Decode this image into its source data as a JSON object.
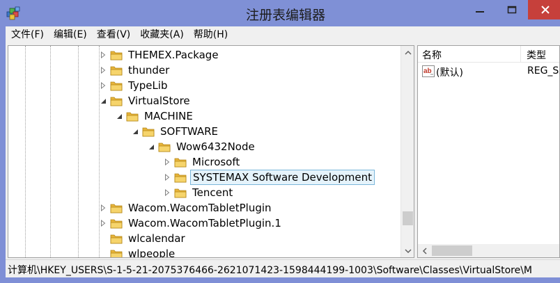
{
  "window": {
    "title": "注册表编辑器",
    "close_color": "#c6403b",
    "titlebar_color": "#7f90d6"
  },
  "menu": [
    {
      "label": "文件(F)"
    },
    {
      "label": "编辑(E)"
    },
    {
      "label": "查看(V)"
    },
    {
      "label": "收藏夹(A)"
    },
    {
      "label": "帮助(H)"
    }
  ],
  "tree": {
    "items": [
      {
        "label": "THEMEX.Package",
        "expander": "collapsed",
        "level": 0
      },
      {
        "label": "thunder",
        "expander": "collapsed",
        "level": 0
      },
      {
        "label": "TypeLib",
        "expander": "collapsed",
        "level": 0
      },
      {
        "label": "VirtualStore",
        "expander": "expanded",
        "level": 0
      },
      {
        "label": "MACHINE",
        "expander": "expanded",
        "level": 1
      },
      {
        "label": "SOFTWARE",
        "expander": "expanded",
        "level": 2
      },
      {
        "label": "Wow6432Node",
        "expander": "expanded",
        "level": 3
      },
      {
        "label": "Microsoft",
        "expander": "collapsed",
        "level": 4
      },
      {
        "label": "SYSTEMAX Software Development",
        "expander": "collapsed",
        "level": 4,
        "selected": true
      },
      {
        "label": "Tencent",
        "expander": "collapsed",
        "level": 4
      },
      {
        "label": "Wacom.WacomTabletPlugin",
        "expander": "collapsed",
        "level": 0
      },
      {
        "label": "Wacom.WacomTabletPlugin.1",
        "expander": "collapsed",
        "level": 0
      },
      {
        "label": "wlcalendar",
        "expander": "none",
        "level": 0
      },
      {
        "label": "wlpeople",
        "expander": "none",
        "level": 0
      }
    ]
  },
  "list": {
    "columns": {
      "name": "名称",
      "type": "类型"
    },
    "rows": [
      {
        "icon": "string-value-icon",
        "name": "(默认)",
        "type": "REG_SZ"
      }
    ]
  },
  "status": {
    "path": "计算机\\HKEY_USERS\\S-1-5-21-2075376466-2621071423-1598444199-1003\\Software\\Classes\\VirtualStore\\M"
  }
}
